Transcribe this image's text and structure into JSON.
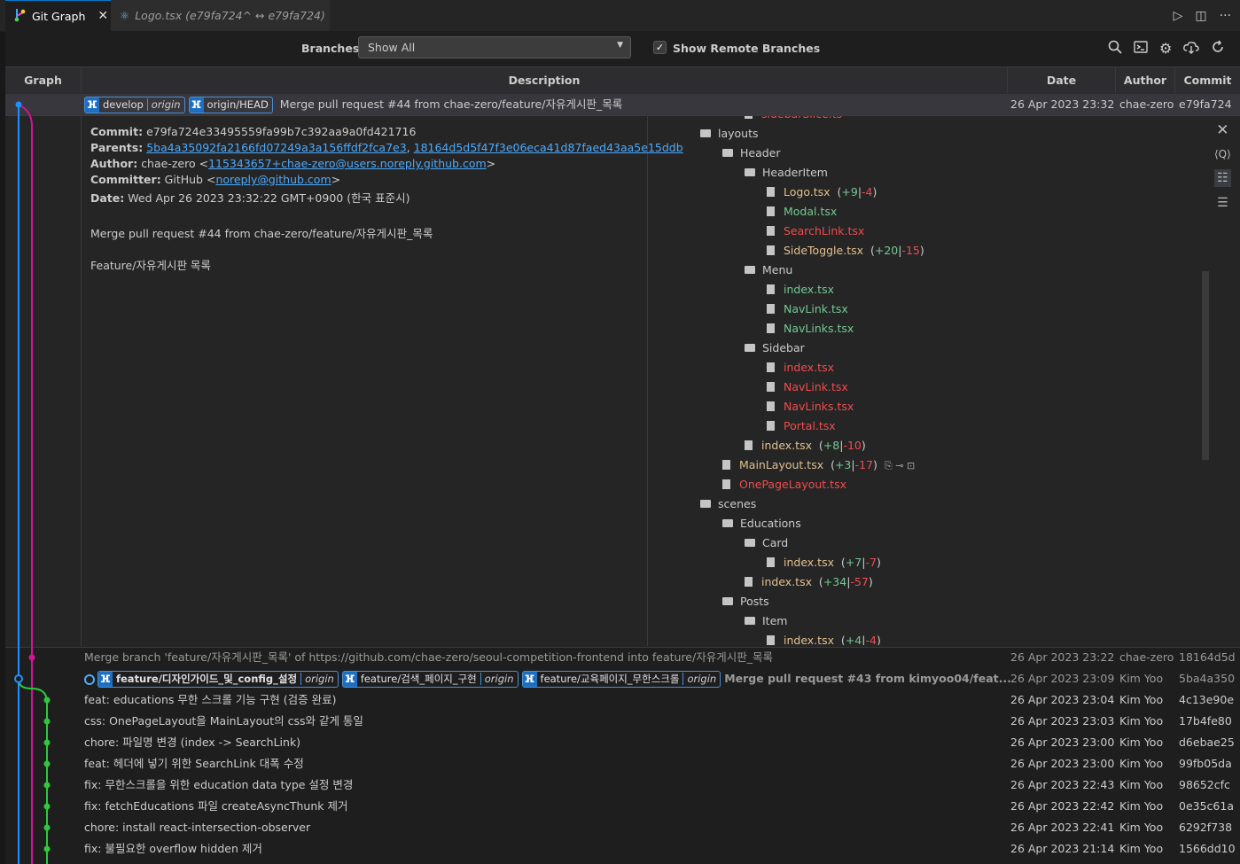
{
  "tabs": [
    {
      "label": "Git Graph",
      "icon": "git-graph-icon"
    },
    {
      "label": "Logo.tsx (e79fa724^ ↔ e79fa724)",
      "icon": "react-icon"
    }
  ],
  "controls": {
    "branches_label": "Branches:",
    "branches_value": "Show All",
    "show_remote_label": "Show Remote Branches",
    "show_remote_checked": true
  },
  "columns": {
    "graph": "Graph",
    "description": "Description",
    "date": "Date",
    "author": "Author",
    "commit": "Commit"
  },
  "selected": {
    "refs": [
      {
        "name": "develop",
        "origin": "origin"
      },
      {
        "name": "origin/HEAD",
        "origin": ""
      }
    ],
    "message": "Merge pull request #44 from chae-zero/feature/자유게시판_목록",
    "date": "26 Apr 2023 23:32",
    "author": "chae-zero",
    "hash": "e79fa724"
  },
  "details": {
    "commit_label": "Commit:",
    "commit": "e79fa724e33495559fa99b7c392aa9a0fd421716",
    "parents_label": "Parents:",
    "parent1": "5ba4a35092fa2166fd07249a3a156ffdf2fca7e3",
    "parent2": "18164d5d5f47f3e06eca41d87faed43aa5e15ddb",
    "author_label": "Author:",
    "author_name": "chae-zero <",
    "author_email": "115343657+chae-zero@users.noreply.github.com",
    "committer_label": "Committer:",
    "committer_name": "GitHub <",
    "committer_email": "noreply@github.com",
    "date_label": "Date:",
    "date": "Wed Apr 26 2023 23:32:22 GMT+0900 (한국 표준시)",
    "body1": "Merge pull request #44 from chae-zero/feature/자유게시판_목록",
    "body2": "Feature/자유게시판 목록"
  },
  "tree": [
    {
      "name": "sidebarSlice.ts",
      "type": "file",
      "status": "del",
      "indent": 2
    },
    {
      "name": "layouts",
      "type": "folder",
      "indent": 0
    },
    {
      "name": "Header",
      "type": "folder",
      "indent": 1
    },
    {
      "name": "HeaderItem",
      "type": "folder",
      "indent": 2
    },
    {
      "name": "Logo.tsx",
      "type": "file",
      "status": "mod",
      "indent": 3,
      "plus": "+9",
      "minus": "-4"
    },
    {
      "name": "Modal.tsx",
      "type": "file",
      "status": "add",
      "indent": 3
    },
    {
      "name": "SearchLink.tsx",
      "type": "file",
      "status": "del",
      "indent": 3
    },
    {
      "name": "SideToggle.tsx",
      "type": "file",
      "status": "mod",
      "indent": 3,
      "plus": "+20",
      "minus": "-15"
    },
    {
      "name": "Menu",
      "type": "folder",
      "indent": 2
    },
    {
      "name": "index.tsx",
      "type": "file",
      "status": "add",
      "indent": 3
    },
    {
      "name": "NavLink.tsx",
      "type": "file",
      "status": "add",
      "indent": 3
    },
    {
      "name": "NavLinks.tsx",
      "type": "file",
      "status": "add",
      "indent": 3
    },
    {
      "name": "Sidebar",
      "type": "folder",
      "indent": 2
    },
    {
      "name": "index.tsx",
      "type": "file",
      "status": "del",
      "indent": 3
    },
    {
      "name": "NavLink.tsx",
      "type": "file",
      "status": "del",
      "indent": 3
    },
    {
      "name": "NavLinks.tsx",
      "type": "file",
      "status": "del",
      "indent": 3
    },
    {
      "name": "Portal.tsx",
      "type": "file",
      "status": "del",
      "indent": 3
    },
    {
      "name": "index.tsx",
      "type": "file",
      "status": "mod",
      "indent": 2,
      "plus": "+8",
      "minus": "-10"
    },
    {
      "name": "MainLayout.tsx",
      "type": "file",
      "status": "mod",
      "indent": 1,
      "plus": "+3",
      "minus": "-17",
      "actions": true
    },
    {
      "name": "OnePageLayout.tsx",
      "type": "file",
      "status": "del",
      "indent": 1
    },
    {
      "name": "scenes",
      "type": "folder",
      "indent": 0
    },
    {
      "name": "Educations",
      "type": "folder",
      "indent": 1
    },
    {
      "name": "Card",
      "type": "folder",
      "indent": 2
    },
    {
      "name": "index.tsx",
      "type": "file",
      "status": "mod",
      "indent": 3,
      "plus": "+7",
      "minus": "-7"
    },
    {
      "name": "index.tsx",
      "type": "file",
      "status": "mod",
      "indent": 2,
      "plus": "+34",
      "minus": "-57"
    },
    {
      "name": "Posts",
      "type": "folder",
      "indent": 1
    },
    {
      "name": "Item",
      "type": "folder",
      "indent": 2
    },
    {
      "name": "index.tsx",
      "type": "file",
      "status": "mod",
      "indent": 3,
      "plus": "+4",
      "minus": "-4"
    }
  ],
  "commits": [
    {
      "message": "Merge branch 'feature/자유게시판_목록' of https://github.com/chae-zero/seoul-competition-frontend into feature/자유게시판_목록",
      "date": "26 Apr 2023 23:22",
      "author": "chae-zero",
      "hash": "18164d5d",
      "dim": true
    },
    {
      "message": "Merge pull request #43 from kimyoo04/feat...",
      "date": "26 Apr 2023 23:09",
      "author": "Kim Yoo",
      "hash": "5ba4a350",
      "dim": true,
      "refs": [
        {
          "name": "feature/디자인가이드_및_config_설정",
          "origin": "origin",
          "bold": true
        },
        {
          "name": "feature/검색_페이지_구현",
          "origin": "origin"
        },
        {
          "name": "feature/교육페이지_무한스크롤",
          "origin": "origin"
        }
      ]
    },
    {
      "message": "feat: educations 무한 스크롤 기능 구현 (검증 완료)",
      "date": "26 Apr 2023 23:04",
      "author": "Kim Yoo",
      "hash": "4c13e90e"
    },
    {
      "message": "css: OnePageLayout을 MainLayout의 css와 같게 통일",
      "date": "26 Apr 2023 23:03",
      "author": "Kim Yoo",
      "hash": "17b4fe80"
    },
    {
      "message": "chore: 파일명 변경 (index -> SearchLink)",
      "date": "26 Apr 2023 23:00",
      "author": "Kim Yoo",
      "hash": "d6ebae25"
    },
    {
      "message": "feat: 헤더에 넣기 위한 SearchLink 대폭 수정",
      "date": "26 Apr 2023 23:00",
      "author": "Kim Yoo",
      "hash": "99fb05da"
    },
    {
      "message": "fix: 무한스크롤을 위한 education data type 설정 변경",
      "date": "26 Apr 2023 22:43",
      "author": "Kim Yoo",
      "hash": "98652cfc"
    },
    {
      "message": "fix: fetchEducations 파일 createAsyncThunk 제거",
      "date": "26 Apr 2023 22:42",
      "author": "Kim Yoo",
      "hash": "0e35c61a"
    },
    {
      "message": "chore: install react-intersection-observer",
      "date": "26 Apr 2023 22:41",
      "author": "Kim Yoo",
      "hash": "6292f738"
    },
    {
      "message": "fix: 불필요한 overflow hidden 제거",
      "date": "26 Apr 2023 21:14",
      "author": "Kim Yoo",
      "hash": "1566dd10"
    }
  ]
}
